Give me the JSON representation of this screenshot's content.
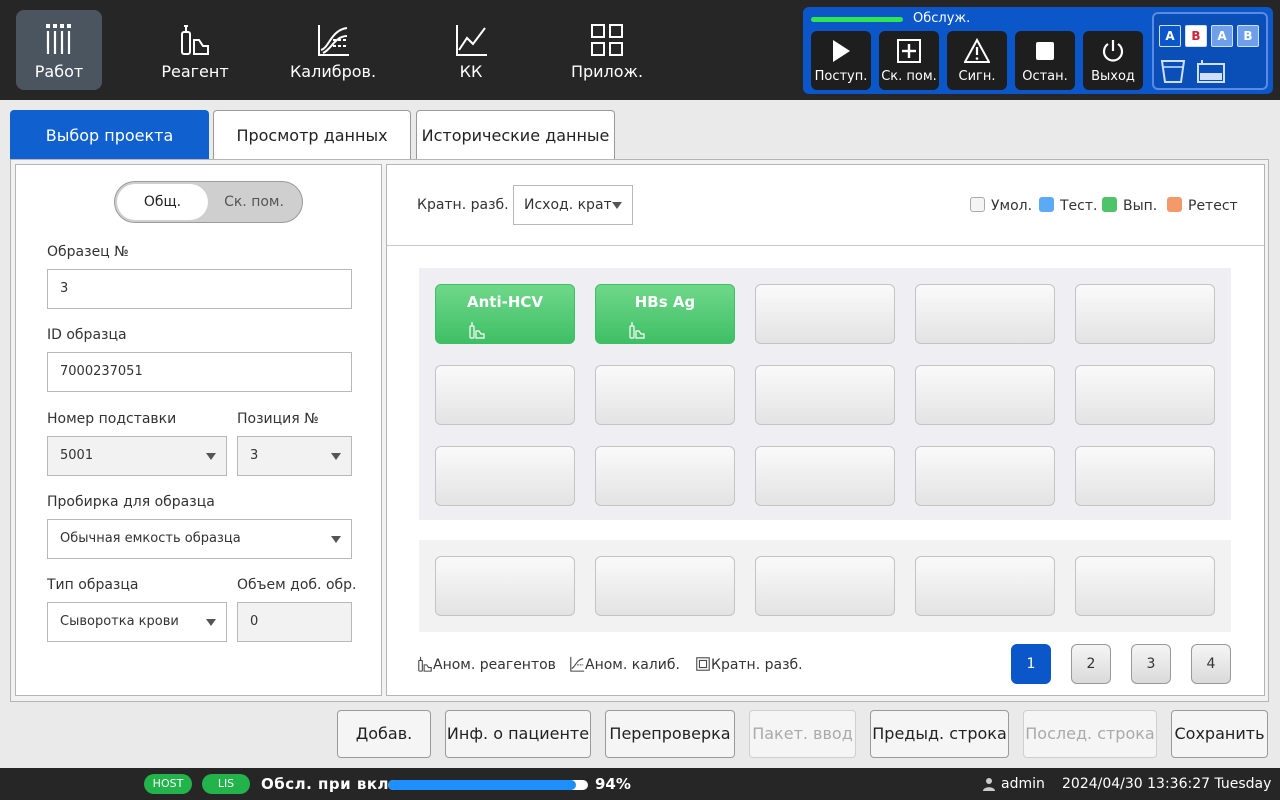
{
  "nav": {
    "items": [
      {
        "label": "Работ",
        "icon": "run-icon",
        "active": true
      },
      {
        "label": "Реагент",
        "icon": "reagent-icon"
      },
      {
        "label": "Калибров.",
        "icon": "calibration-icon"
      },
      {
        "label": "КК",
        "icon": "qc-chart-icon"
      },
      {
        "label": "Прилож.",
        "icon": "apps-grid-icon"
      }
    ]
  },
  "control": {
    "maintenance_label": "Обслуж.",
    "buttons": [
      {
        "label": "Поступ.",
        "icon": "play-icon"
      },
      {
        "label": "Ск. пом.",
        "icon": "plus-icon"
      },
      {
        "label": "Сигн.",
        "icon": "warning-icon"
      },
      {
        "label": "Остан.",
        "icon": "stop-icon"
      },
      {
        "label": "Выход",
        "icon": "power-icon"
      }
    ],
    "reagent_slots": [
      "A",
      "B",
      "A",
      "B"
    ]
  },
  "tabs": [
    "Выбор проекта",
    "Просмотр данных",
    "Исторические данные"
  ],
  "left": {
    "toggle_on": "Общ.",
    "toggle_off": "Ск. пом.",
    "sample_no_label": "Образец №",
    "sample_no_value": "3",
    "sample_id_label": "ID образца",
    "sample_id_value": "7000237051",
    "rack_label": "Номер подставки",
    "rack_value": "5001",
    "pos_label": "Позиция №",
    "pos_value": "3",
    "tube_label": "Пробирка для образца",
    "tube_value": "Обычная емкость образца",
    "type_label": "Тип образца",
    "type_value": "Сыворотка крови",
    "volume_label": "Объем доб. обр.",
    "volume_value": "0"
  },
  "right": {
    "dilution_label": "Кратн. разб.",
    "dilution_value": "Исход. крат",
    "legend": [
      {
        "label": "Умол.",
        "color": "#f4f4f4"
      },
      {
        "label": "Тест.",
        "color": "#5aaaf5"
      },
      {
        "label": "Вып.",
        "color": "#4ec46a"
      },
      {
        "label": "Ретест",
        "color": "#f49a6a"
      }
    ],
    "tests": [
      "Anti-HCV",
      "HBs Ag"
    ],
    "footer_legend": [
      "Аном. реагентов",
      "Аном. калиб.",
      "Кратн. разб."
    ],
    "pages": [
      "1",
      "2",
      "3",
      "4"
    ]
  },
  "bottom_buttons": [
    {
      "label": "Добав.",
      "enabled": true
    },
    {
      "label": "Инф. о пациенте",
      "enabled": true
    },
    {
      "label": "Перепроверка",
      "enabled": true
    },
    {
      "label": "Пакет. ввод",
      "enabled": false
    },
    {
      "label": "Предыд. строка",
      "enabled": true
    },
    {
      "label": "Послед. строка",
      "enabled": false
    },
    {
      "label": "Сохранить",
      "enabled": true
    }
  ],
  "status": {
    "host": "HOST",
    "lis": "LIS",
    "boot_label": "Обсл. при вкл.",
    "progress_percent": "94%",
    "progress": 0.94,
    "user": "admin",
    "datetime": "2024/04/30  13:36:27  Tuesday"
  }
}
